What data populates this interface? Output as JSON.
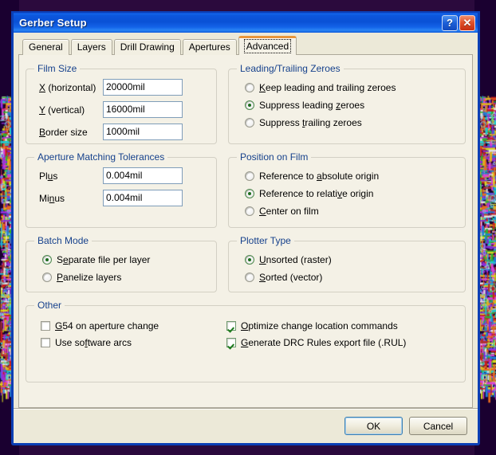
{
  "window": {
    "title": "Gerber Setup",
    "help_button": "?",
    "close_button": "✕"
  },
  "tabs": [
    {
      "label": "General",
      "active": false
    },
    {
      "label": "Layers",
      "active": false
    },
    {
      "label": "Drill Drawing",
      "active": false
    },
    {
      "label": "Apertures",
      "active": false
    },
    {
      "label": "Advanced",
      "active": true
    }
  ],
  "groups": {
    "film_size": {
      "title": "Film Size",
      "fields": [
        {
          "label_pre": "",
          "label_accel": "X",
          "label_post": " (horizontal)",
          "value": "20000mil"
        },
        {
          "label_pre": "",
          "label_accel": "Y",
          "label_post": " (vertical)",
          "value": "16000mil"
        },
        {
          "label_pre": "",
          "label_accel": "B",
          "label_post": "order size",
          "value": "1000mil"
        }
      ]
    },
    "tolerances": {
      "title": "Aperture Matching Tolerances",
      "fields": [
        {
          "label_pre": "Pl",
          "label_accel": "u",
          "label_post": "s",
          "value": "0.004mil"
        },
        {
          "label_pre": "Mi",
          "label_accel": "n",
          "label_post": "us",
          "value": "0.004mil"
        }
      ]
    },
    "batch_mode": {
      "title": "Batch Mode",
      "options": [
        {
          "pre": "S",
          "accel": "e",
          "post": "parate file per layer",
          "checked": true
        },
        {
          "pre": "",
          "accel": "P",
          "post": "anelize layers",
          "checked": false
        }
      ]
    },
    "zeroes": {
      "title": "Leading/Trailing Zeroes",
      "options": [
        {
          "pre": "",
          "accel": "K",
          "post": "eep leading and trailing zeroes",
          "checked": false
        },
        {
          "pre": "Suppress leading ",
          "accel": "z",
          "post": "eroes",
          "checked": true
        },
        {
          "pre": "Suppress ",
          "accel": "t",
          "post": "railing zeroes",
          "checked": false
        }
      ]
    },
    "position": {
      "title": "Position on Film",
      "options": [
        {
          "pre": "Reference to ",
          "accel": "a",
          "post": "bsolute origin",
          "checked": false
        },
        {
          "pre": "Reference to relati",
          "accel": "v",
          "post": "e origin",
          "checked": true
        },
        {
          "pre": "",
          "accel": "C",
          "post": "enter on film",
          "checked": false
        }
      ]
    },
    "plotter": {
      "title": "Plotter Type",
      "options": [
        {
          "pre": "",
          "accel": "U",
          "post": "nsorted (raster)",
          "checked": true
        },
        {
          "pre": "",
          "accel": "S",
          "post": "orted (vector)",
          "checked": false
        }
      ]
    },
    "other": {
      "title": "Other",
      "checkboxes_left": [
        {
          "pre": "",
          "accel": "G",
          "post": "54 on aperture change",
          "checked": false
        },
        {
          "pre": "Use so",
          "accel": "f",
          "post": "tware arcs",
          "checked": false
        }
      ],
      "checkboxes_right": [
        {
          "pre": "",
          "accel": "O",
          "post": "ptimize change location commands",
          "checked": true
        },
        {
          "pre": "",
          "accel": "G",
          "post": "enerate DRC Rules export file (.RUL)",
          "checked": true
        }
      ]
    }
  },
  "buttons": {
    "ok": "OK",
    "cancel": "Cancel"
  },
  "colors": {
    "titlebar_blue": "#0a51d6",
    "window_border": "#0b3fb5",
    "dialog_face": "#ece9d8",
    "tab_page": "#f4f1e6",
    "group_label": "#16418c",
    "active_tab_accent": "#e8963b",
    "radio_dot": "#1d6b1d",
    "check_mark": "#1d7a1d",
    "close_button": "#c62f12"
  }
}
